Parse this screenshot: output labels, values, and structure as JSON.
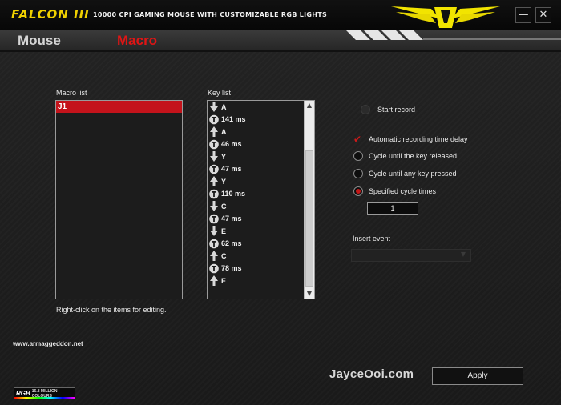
{
  "window": {
    "brand": "FALCON III",
    "subtitle": "10000 CPI GAMING MOUSE WITH CUSTOMIZABLE RGB LIGHTS",
    "minimize": "—",
    "close": "✕"
  },
  "tabs": [
    {
      "label": "Mouse",
      "active": false
    },
    {
      "label": "Macro",
      "active": true
    }
  ],
  "macro_list": {
    "label": "Macro list",
    "items": [
      {
        "label": "J1",
        "selected": true
      }
    ]
  },
  "key_list": {
    "label": "Key list",
    "rows": [
      {
        "icon": "down-arrow-icon",
        "text": "A"
      },
      {
        "icon": "timer-icon",
        "text": "141 ms"
      },
      {
        "icon": "up-arrow-icon",
        "text": "A"
      },
      {
        "icon": "timer-icon",
        "text": "46 ms"
      },
      {
        "icon": "down-arrow-icon",
        "text": "Y"
      },
      {
        "icon": "timer-icon",
        "text": "47 ms"
      },
      {
        "icon": "up-arrow-icon",
        "text": "Y"
      },
      {
        "icon": "timer-icon",
        "text": "110 ms"
      },
      {
        "icon": "down-arrow-icon",
        "text": "C"
      },
      {
        "icon": "timer-icon",
        "text": "47 ms"
      },
      {
        "icon": "down-arrow-icon",
        "text": "E"
      },
      {
        "icon": "timer-icon",
        "text": "62 ms"
      },
      {
        "icon": "up-arrow-icon",
        "text": "C"
      },
      {
        "icon": "timer-icon",
        "text": "78 ms"
      },
      {
        "icon": "up-arrow-icon",
        "text": "E"
      }
    ]
  },
  "hint": "Right-click on the items for editing.",
  "website": "www.armaggeddon.net",
  "options": {
    "start_record": "Start record",
    "auto_delay": "Automatic recording time delay",
    "cycle_released": "Cycle until the key released",
    "cycle_any": "Cycle until any key pressed",
    "cycle_times": "Specified cycle times",
    "cycle_value": "1",
    "insert_event": "Insert event",
    "selected_mode": "Specified cycle times"
  },
  "footer": {
    "watermark": "JayceOoi.com",
    "apply": "Apply",
    "rgb_word": "RGB",
    "rgb_small": "16.8 MILLION COLOURS"
  },
  "colors": {
    "accent_red": "#c4131b",
    "brand_yellow": "#f0d000"
  }
}
